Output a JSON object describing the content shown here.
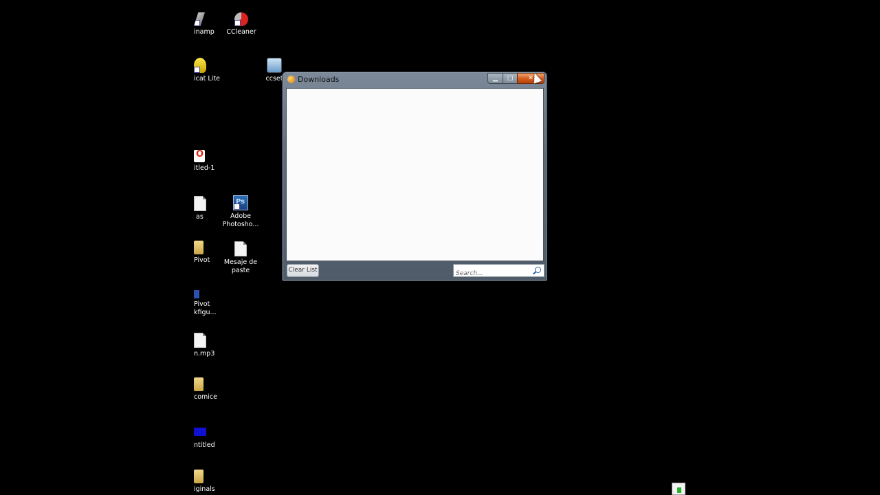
{
  "desktop": {
    "icons": [
      {
        "label": "inamp",
        "icon": "winamp-icon"
      },
      {
        "label": "CCleaner",
        "icon": "ccleaner-icon"
      },
      {
        "label": "icat Lite",
        "icon": "bandicam-icon"
      },
      {
        "label": "ccset",
        "icon": "ccsetup-icon"
      },
      {
        "label": "itled-1",
        "icon": "opera-icon"
      },
      {
        "label": "as",
        "icon": "text-file-icon"
      },
      {
        "label": "Adobe Photosho...",
        "icon": "photoshop-icon"
      },
      {
        "label": "Pivot",
        "icon": "folder-icon"
      },
      {
        "label": "Mesaje de paste",
        "icon": "text-file-icon"
      },
      {
        "label": "Pivot kfigu...",
        "icon": "pivot-icon"
      },
      {
        "label": "n.mp3",
        "icon": "text-file-icon"
      },
      {
        "label": "comice",
        "icon": "folder-icon"
      },
      {
        "label": "ntitled",
        "icon": "blue-image-icon"
      },
      {
        "label": "iginals",
        "icon": "folder-icon"
      }
    ]
  },
  "downloads_window": {
    "title": "Downloads",
    "minimize_symbol": "▁",
    "maximize_symbol": "□",
    "close_symbol": "✕",
    "clear_list_label": "Clear List",
    "search_placeholder": "Search..."
  },
  "colors": {
    "desktop_background": "#000000",
    "close_button": "#d35a1a"
  }
}
